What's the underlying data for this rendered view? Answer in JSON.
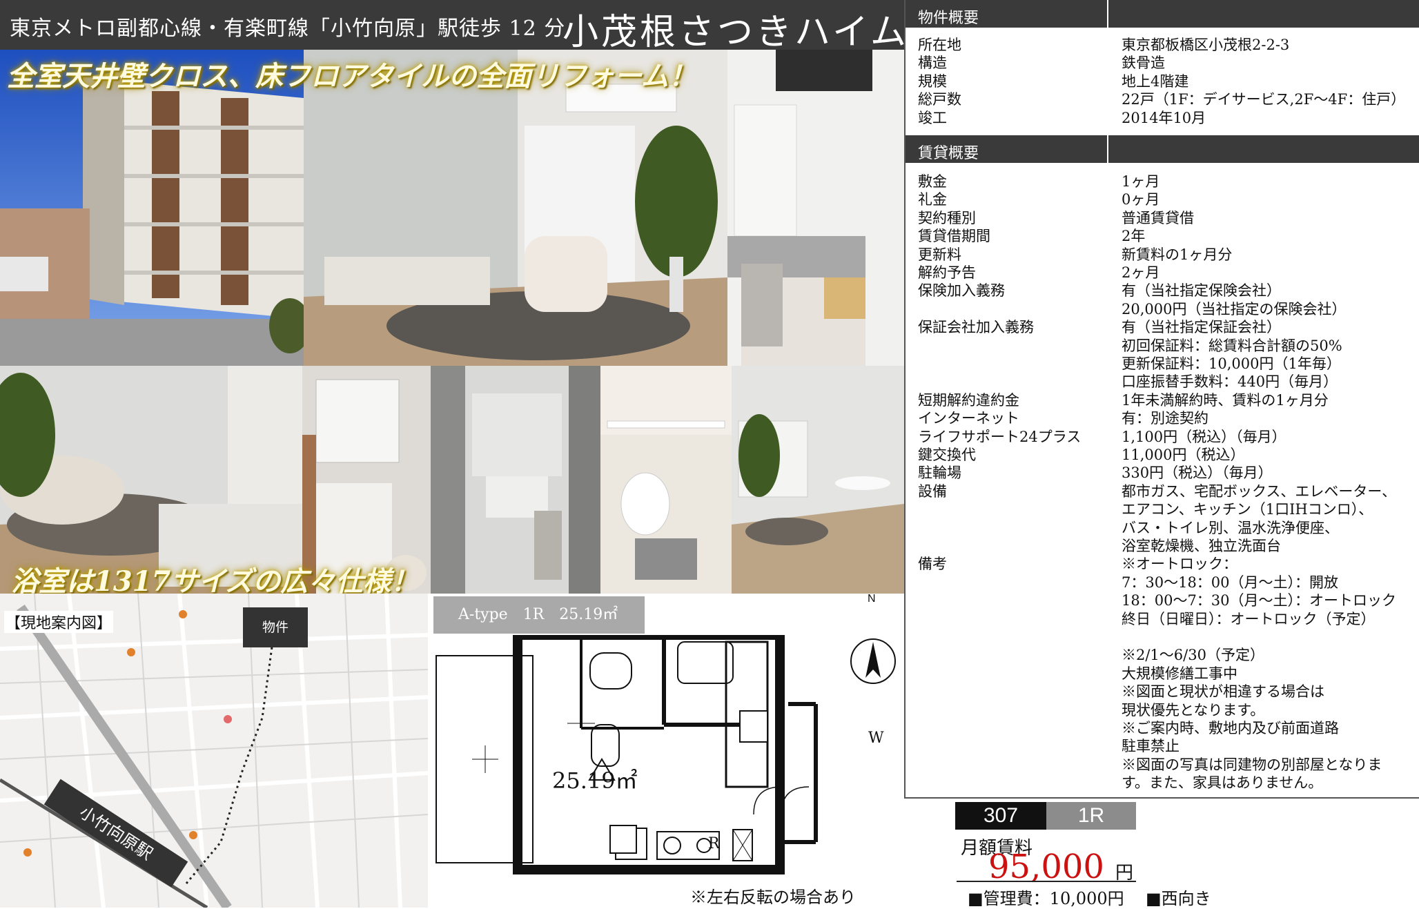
{
  "header": {
    "station": "東京メトロ副都心線・有楽町線「小竹向原」駅徒歩 12 分",
    "name": "小茂根さつきハイム"
  },
  "photos": {
    "caption_top": "全室天井壁クロス、床フロアタイルの全面リフォーム！",
    "caption_bottom": "浴室は1317サイズの広々仕様！"
  },
  "property_overview": {
    "title": "物件概要",
    "rows": [
      {
        "label": "所在地",
        "value": "東京都板橋区小茂根2-2-3"
      },
      {
        "label": "構造",
        "value": "鉄骨造"
      },
      {
        "label": "規模",
        "value": "地上4階建"
      },
      {
        "label": "総戸数",
        "value": "22戸（1F：デイサービス,2F～4F：住戸）"
      },
      {
        "label": "竣工",
        "value": "2014年10月"
      }
    ]
  },
  "rental_overview": {
    "title": "賃貸概要",
    "rows": [
      {
        "label": "敷金",
        "values": [
          "1ヶ月"
        ]
      },
      {
        "label": "礼金",
        "values": [
          "0ヶ月"
        ]
      },
      {
        "label": "契約種別",
        "values": [
          "普通賃貸借"
        ]
      },
      {
        "label": "賃貸借期間",
        "values": [
          "2年"
        ]
      },
      {
        "label": "更新料",
        "values": [
          "新賃料の1ヶ月分"
        ]
      },
      {
        "label": "解約予告",
        "values": [
          "2ヶ月"
        ]
      },
      {
        "label": "保険加入義務",
        "values": [
          "有（当社指定保険会社）",
          "20,000円（当社指定の保険会社）"
        ]
      },
      {
        "label": "保証会社加入義務",
        "values": [
          "有（当社指定保証会社）",
          "初回保証料：総賃料合計額の50%",
          "更新保証料：10,000円（1年毎）",
          "口座振替手数料：440円（毎月）"
        ]
      },
      {
        "label": "短期解約違約金",
        "values": [
          "1年未満解約時、賃料の1ヶ月分"
        ]
      },
      {
        "label": "インターネット",
        "values": [
          "有：別途契約"
        ]
      },
      {
        "label": "ライフサポート24プラス",
        "values": [
          "1,100円（税込）（毎月）"
        ]
      },
      {
        "label": "鍵交換代",
        "values": [
          "11,000円（税込）"
        ]
      },
      {
        "label": "駐輪場",
        "values": [
          "330円（税込）（毎月）"
        ]
      },
      {
        "label": "設備",
        "values": [
          "都市ガス、宅配ボックス、エレベーター、",
          "エアコン、キッチン（1口IHコンロ）、",
          "バス・トイレ別、温水洗浄便座、",
          "浴室乾燥機、独立洗面台"
        ]
      },
      {
        "label": "備考",
        "values": [
          "※オートロック：",
          "7：30～18：00（月～土）：開放",
          "18：00～7：30（月～土）：オートロック",
          "終日（日曜日）：オートロック（予定）",
          "",
          "※2/1～6/30（予定）",
          "大規模修繕工事中",
          "※図面と現状が相違する場合は",
          "現状優先となります。",
          "※ご案内時、敷地内及び前面道路",
          "駐車禁止",
          "※図面の写真は同建物の別部屋となりま",
          "す。また、家具はありません。"
        ]
      }
    ]
  },
  "map": {
    "title": "【現地案内図】",
    "property_label": "物件",
    "station_label": "小竹向原駅"
  },
  "floor_plan": {
    "type_label": "A-type　1R　25.19㎡",
    "area": "25.19㎡",
    "north": "N",
    "bath_marker": "W",
    "fridge_marker": "R",
    "note": "※左右反転の場合あり"
  },
  "price": {
    "room_no": "307",
    "room_type": "1R",
    "rent_label": "月額賃料",
    "rent": "95,000",
    "rent_unit": "円",
    "management": "■管理費：10,000円",
    "facing": "■西向き"
  }
}
